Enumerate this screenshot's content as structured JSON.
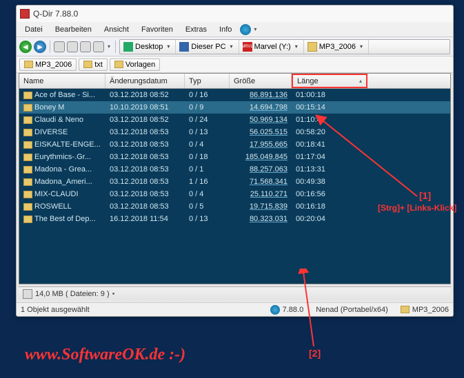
{
  "window": {
    "title": "Q-Dir 7.88.0"
  },
  "menu": {
    "file": "Datei",
    "edit": "Bearbeiten",
    "view": "Ansicht",
    "favorites": "Favoriten",
    "extras": "Extras",
    "info": "Info"
  },
  "breadcrumb": {
    "desktop": "Desktop",
    "pc": "Dieser PC",
    "drive": "Marvel (Y:)",
    "folder": "MP3_2006",
    "drive_badge": "MRVL"
  },
  "folder_tabs": {
    "t1": "MP3_2006",
    "t2": "txt",
    "t3": "Vorlagen"
  },
  "columns": {
    "name": "Name",
    "date": "Änderungsdatum",
    "typ": "Typ",
    "size": "Größe",
    "len": "Länge"
  },
  "rows": [
    {
      "name": "Ace of Base - Si...",
      "date": "03.12.2018 08:52",
      "typ": "0 / 16",
      "size": "86.891.136",
      "len": "01:00:18",
      "selected": false
    },
    {
      "name": "Boney M",
      "date": "10.10.2019 08:51",
      "typ": "0 / 9",
      "size": "14.694.798",
      "len": "00:15:14",
      "selected": true
    },
    {
      "name": "Claudi & Neno",
      "date": "03.12.2018 08:52",
      "typ": "0 / 24",
      "size": "50.969.134",
      "len": "01:10:41",
      "selected": false
    },
    {
      "name": "DIVERSE",
      "date": "03.12.2018 08:53",
      "typ": "0 / 13",
      "size": "56.025.515",
      "len": "00:58:20",
      "selected": false
    },
    {
      "name": "EISKALTE-ENGE...",
      "date": "03.12.2018 08:53",
      "typ": "0 / 4",
      "size": "17.955.665",
      "len": "00:18:41",
      "selected": false
    },
    {
      "name": "Eurythmics-.Gr...",
      "date": "03.12.2018 08:53",
      "typ": "0 / 18",
      "size": "185.049.845",
      "len": "01:17:04",
      "selected": false
    },
    {
      "name": "Madona - Grea...",
      "date": "03.12.2018 08:53",
      "typ": "0 / 1",
      "size": "88.257.063",
      "len": "01:13:31",
      "selected": false
    },
    {
      "name": "Madona_Ameri...",
      "date": "03.12.2018 08:53",
      "typ": "1 / 16",
      "size": "71.568.341",
      "len": "00:49:38",
      "selected": false
    },
    {
      "name": "MIX-CLAUDI",
      "date": "03.12.2018 08:53",
      "typ": "0 / 4",
      "size": "25.110.271",
      "len": "00:16:56",
      "selected": false
    },
    {
      "name": "ROSWELL",
      "date": "03.12.2018 08:53",
      "typ": "0 / 5",
      "size": "19.715.839",
      "len": "00:16:18",
      "selected": false
    },
    {
      "name": "The Best of Dep...",
      "date": "16.12.2018 11:54",
      "typ": "0 / 13",
      "size": "80.323.031",
      "len": "00:20:04",
      "selected": false
    }
  ],
  "status_inner": "14,0 MB  ( Dateien: 9  )",
  "status_inner_dot": "•",
  "status_outer": {
    "sel": "1 Objekt ausgewählt",
    "ver": "7.88.0",
    "user": "Nenad (Portabel/x64)",
    "folder": "MP3_2006"
  },
  "annot": {
    "a1": "[1]",
    "a1b": "[Strg]+ [Links-Klick]",
    "a2": "[2]"
  },
  "watermark": "www.SoftwareOK.de :-)"
}
